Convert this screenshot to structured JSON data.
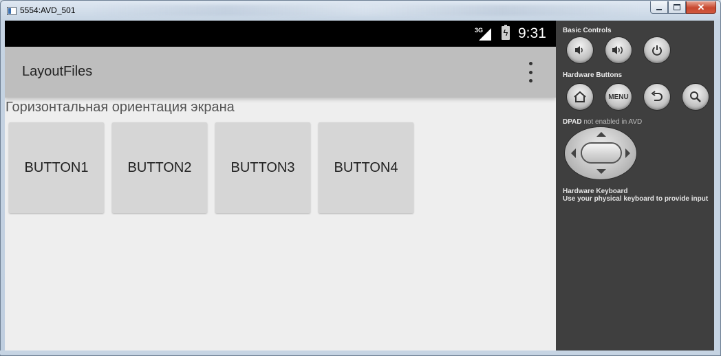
{
  "window": {
    "title": "5554:AVD_501",
    "minimize_icon": "minimize-icon",
    "maximize_icon": "maximize-icon",
    "close_glyph": "✕"
  },
  "status_bar": {
    "network": "3G",
    "time": "9:31",
    "battery_icon": "battery-charging-icon",
    "signal_icon": "signal-icon"
  },
  "action_bar": {
    "title": "LayoutFiles",
    "overflow_icon": "overflow-menu-icon"
  },
  "content": {
    "orientation_text": "Горизонтальная ориентация экрана",
    "buttons": [
      "BUTTON1",
      "BUTTON2",
      "BUTTON3",
      "BUTTON4"
    ]
  },
  "controls": {
    "basic_controls_label": "Basic Controls",
    "hardware_buttons_label": "Hardware Buttons",
    "menu_label": "MENU",
    "dpad_label": "DPAD",
    "dpad_note": "not enabled in AVD",
    "keyboard_title": "Hardware Keyboard",
    "keyboard_desc": "Use your physical keyboard to provide input"
  }
}
